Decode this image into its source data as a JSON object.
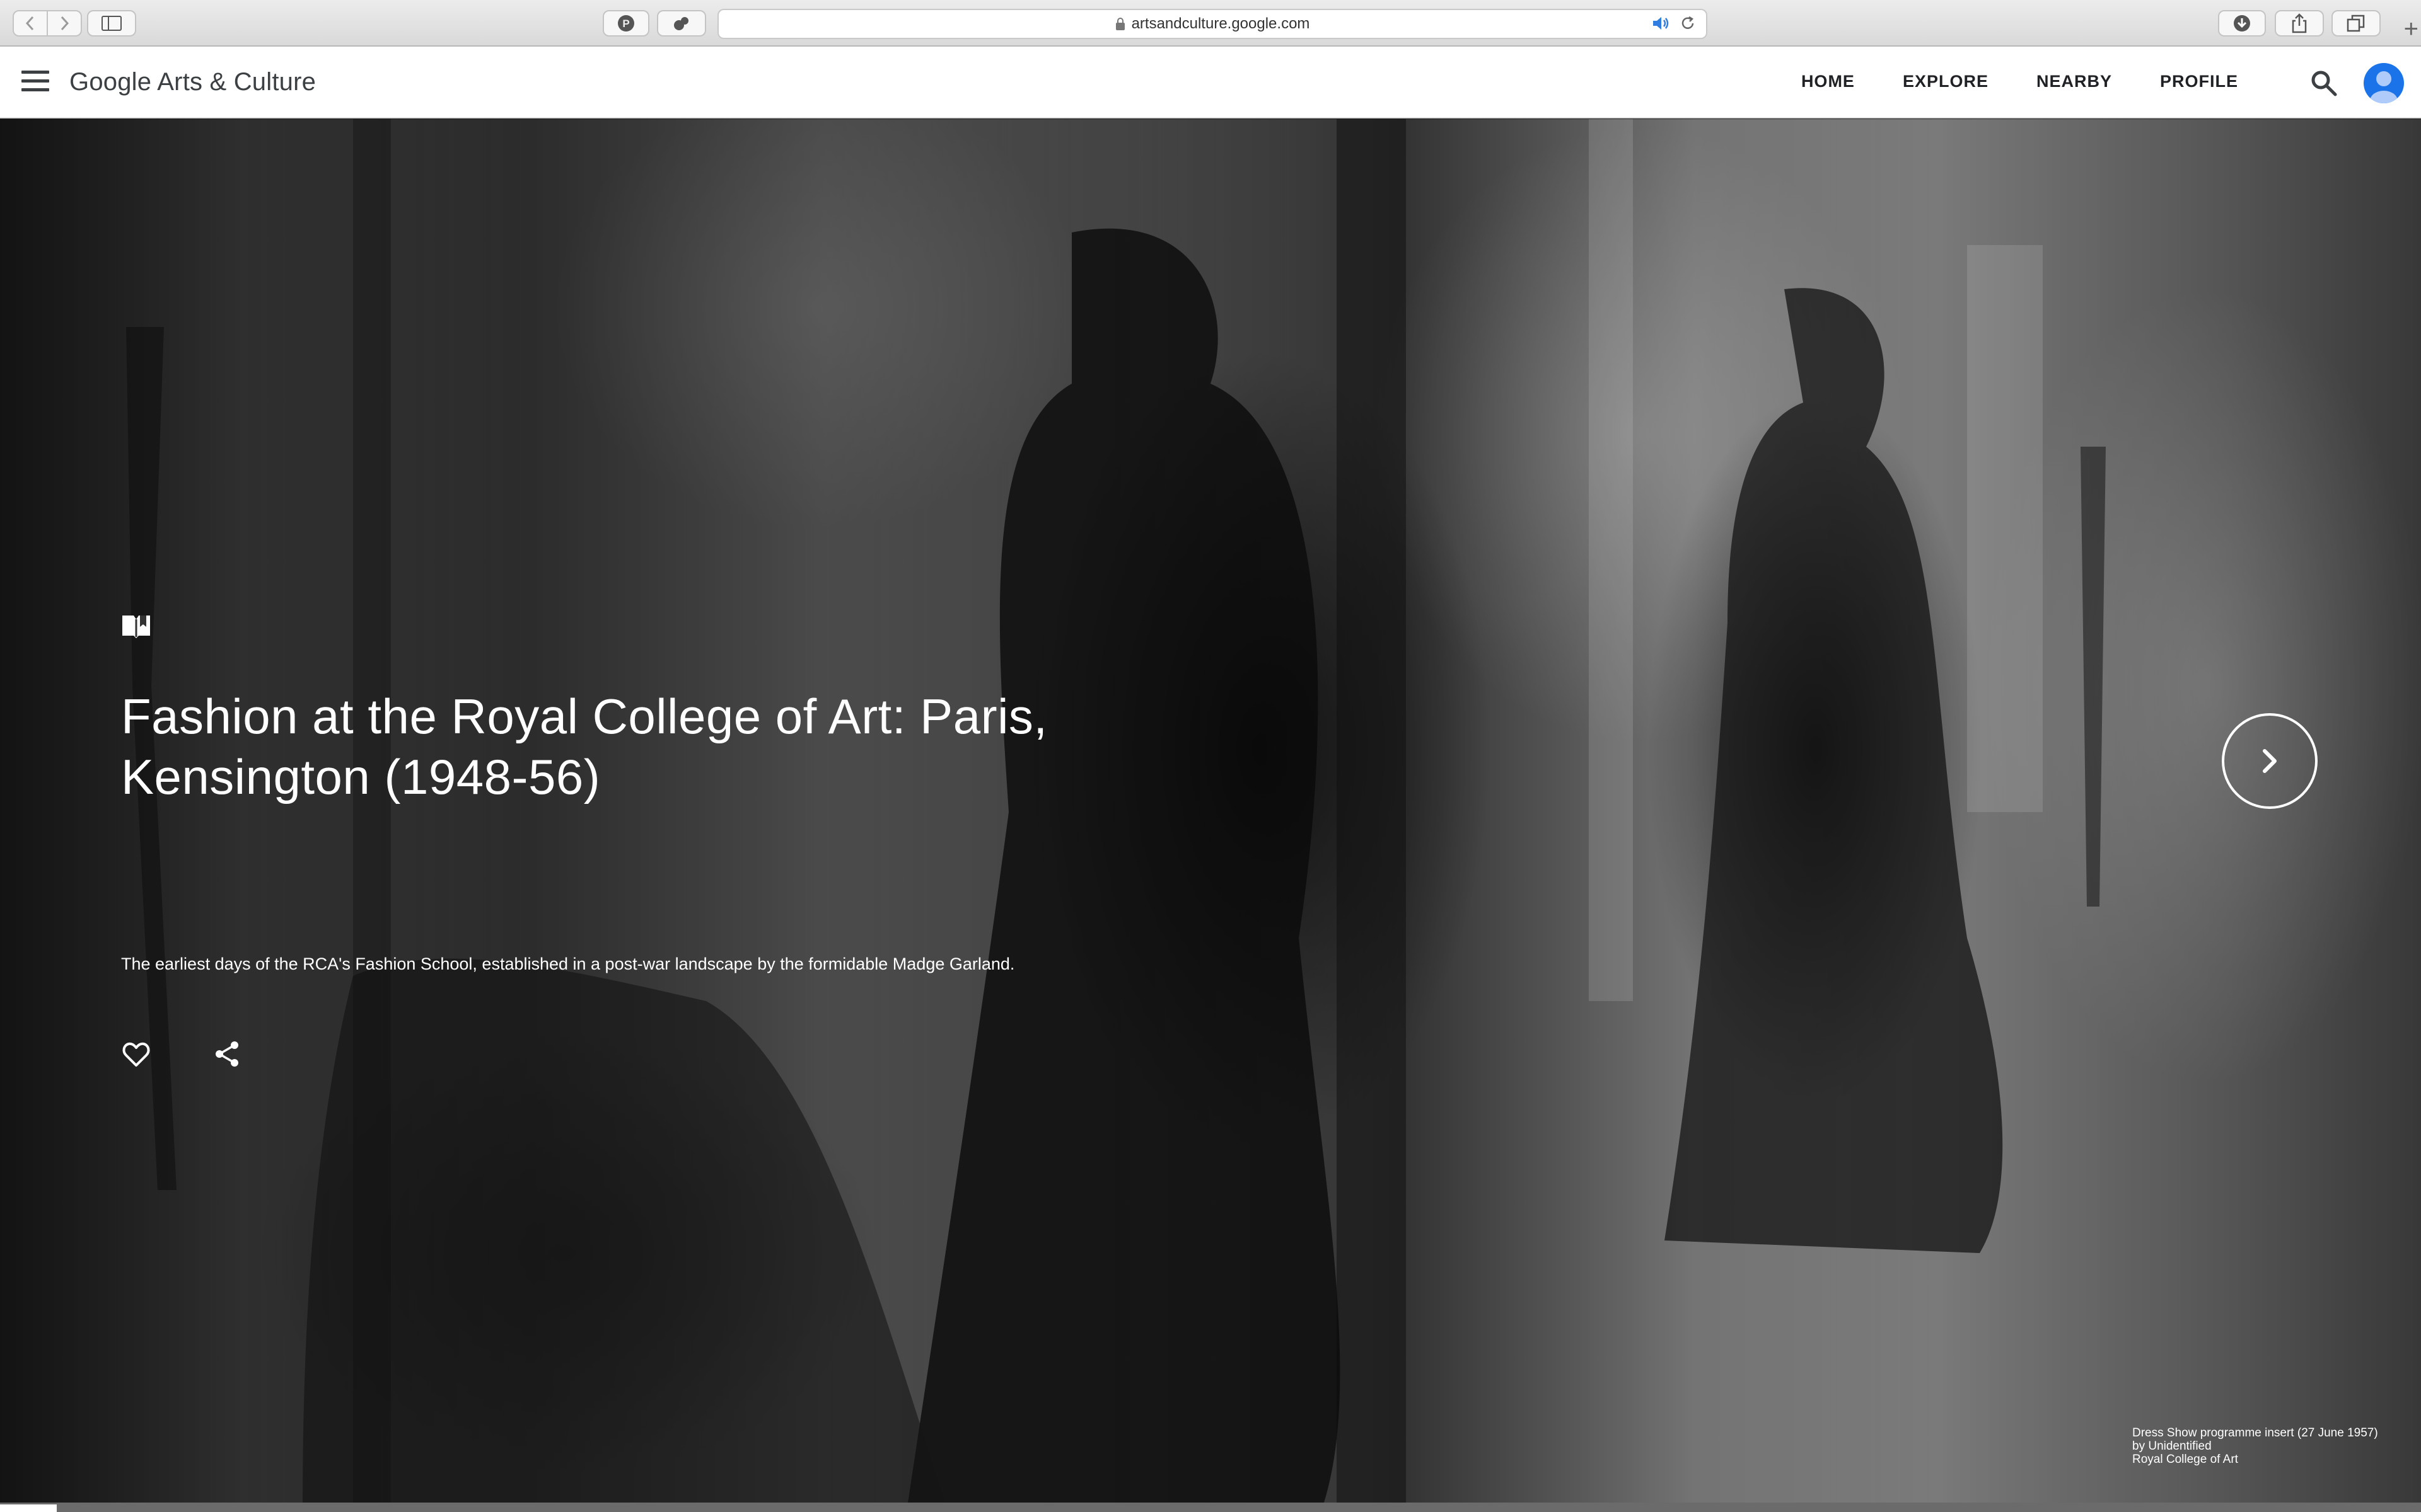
{
  "browser": {
    "url": "artsandculture.google.com",
    "new_tab_symbol": "+"
  },
  "header": {
    "logo": "Google Arts & Culture",
    "nav": [
      "HOME",
      "EXPLORE",
      "NEARBY",
      "PROFILE"
    ]
  },
  "hero": {
    "title": "Fashion at the Royal College of Art: Paris, Kensington (1948-56)",
    "description": "The earliest days of the RCA's Fashion School, established in a post-war landscape by the formidable Madge Garland.",
    "credit": {
      "line1": "Dress Show programme insert (27 June 1957)",
      "line2": "by Unidentified",
      "line3": "Royal College of Art"
    }
  },
  "icons": {
    "back": "chevron-left-icon",
    "forward": "chevron-right-icon",
    "sidebar": "sidebar-icon",
    "pinterest": "pinterest-icon",
    "extension": "extension-icon",
    "lock": "lock-icon",
    "speaker": "speaker-icon",
    "reload": "reload-icon",
    "downloads": "download-icon",
    "share": "share-icon",
    "tabs": "tabs-icon",
    "menu": "menu-icon",
    "search": "search-icon",
    "story": "story-icon",
    "favorite": "heart-icon",
    "next": "chevron-right-icon"
  },
  "colors": {
    "accent_blue": "#1a73e8",
    "header_bg": "#ffffff",
    "text_dark": "#202124"
  }
}
